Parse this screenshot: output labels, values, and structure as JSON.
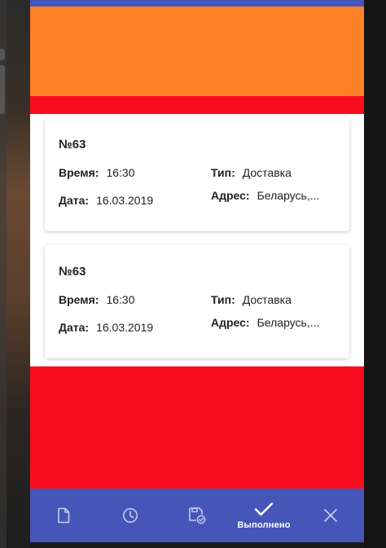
{
  "orders": [
    {
      "number": "№63",
      "time_label": "Время:",
      "time": "16:30",
      "date_label": "Дата:",
      "date": "16.03.2019",
      "type_label": "Тип:",
      "type": "Доставка",
      "address_label": "Адрес:",
      "address": "Беларусь,..."
    },
    {
      "number": "№63",
      "time_label": "Время:",
      "time": "16:30",
      "date_label": "Дата:",
      "date": "16.03.2019",
      "type_label": "Тип:",
      "type": "Доставка",
      "address_label": "Адрес:",
      "address": "Беларусь,..."
    }
  ],
  "nav": {
    "items": [
      {
        "icon": "document-icon",
        "label": ""
      },
      {
        "icon": "clock-icon",
        "label": ""
      },
      {
        "icon": "save-check-icon",
        "label": ""
      },
      {
        "icon": "check-icon",
        "label": "Выполнено"
      },
      {
        "icon": "close-icon",
        "label": ""
      }
    ]
  },
  "colors": {
    "primary": "#4556b8",
    "orange": "#fe8125",
    "red": "#f80e1e"
  }
}
